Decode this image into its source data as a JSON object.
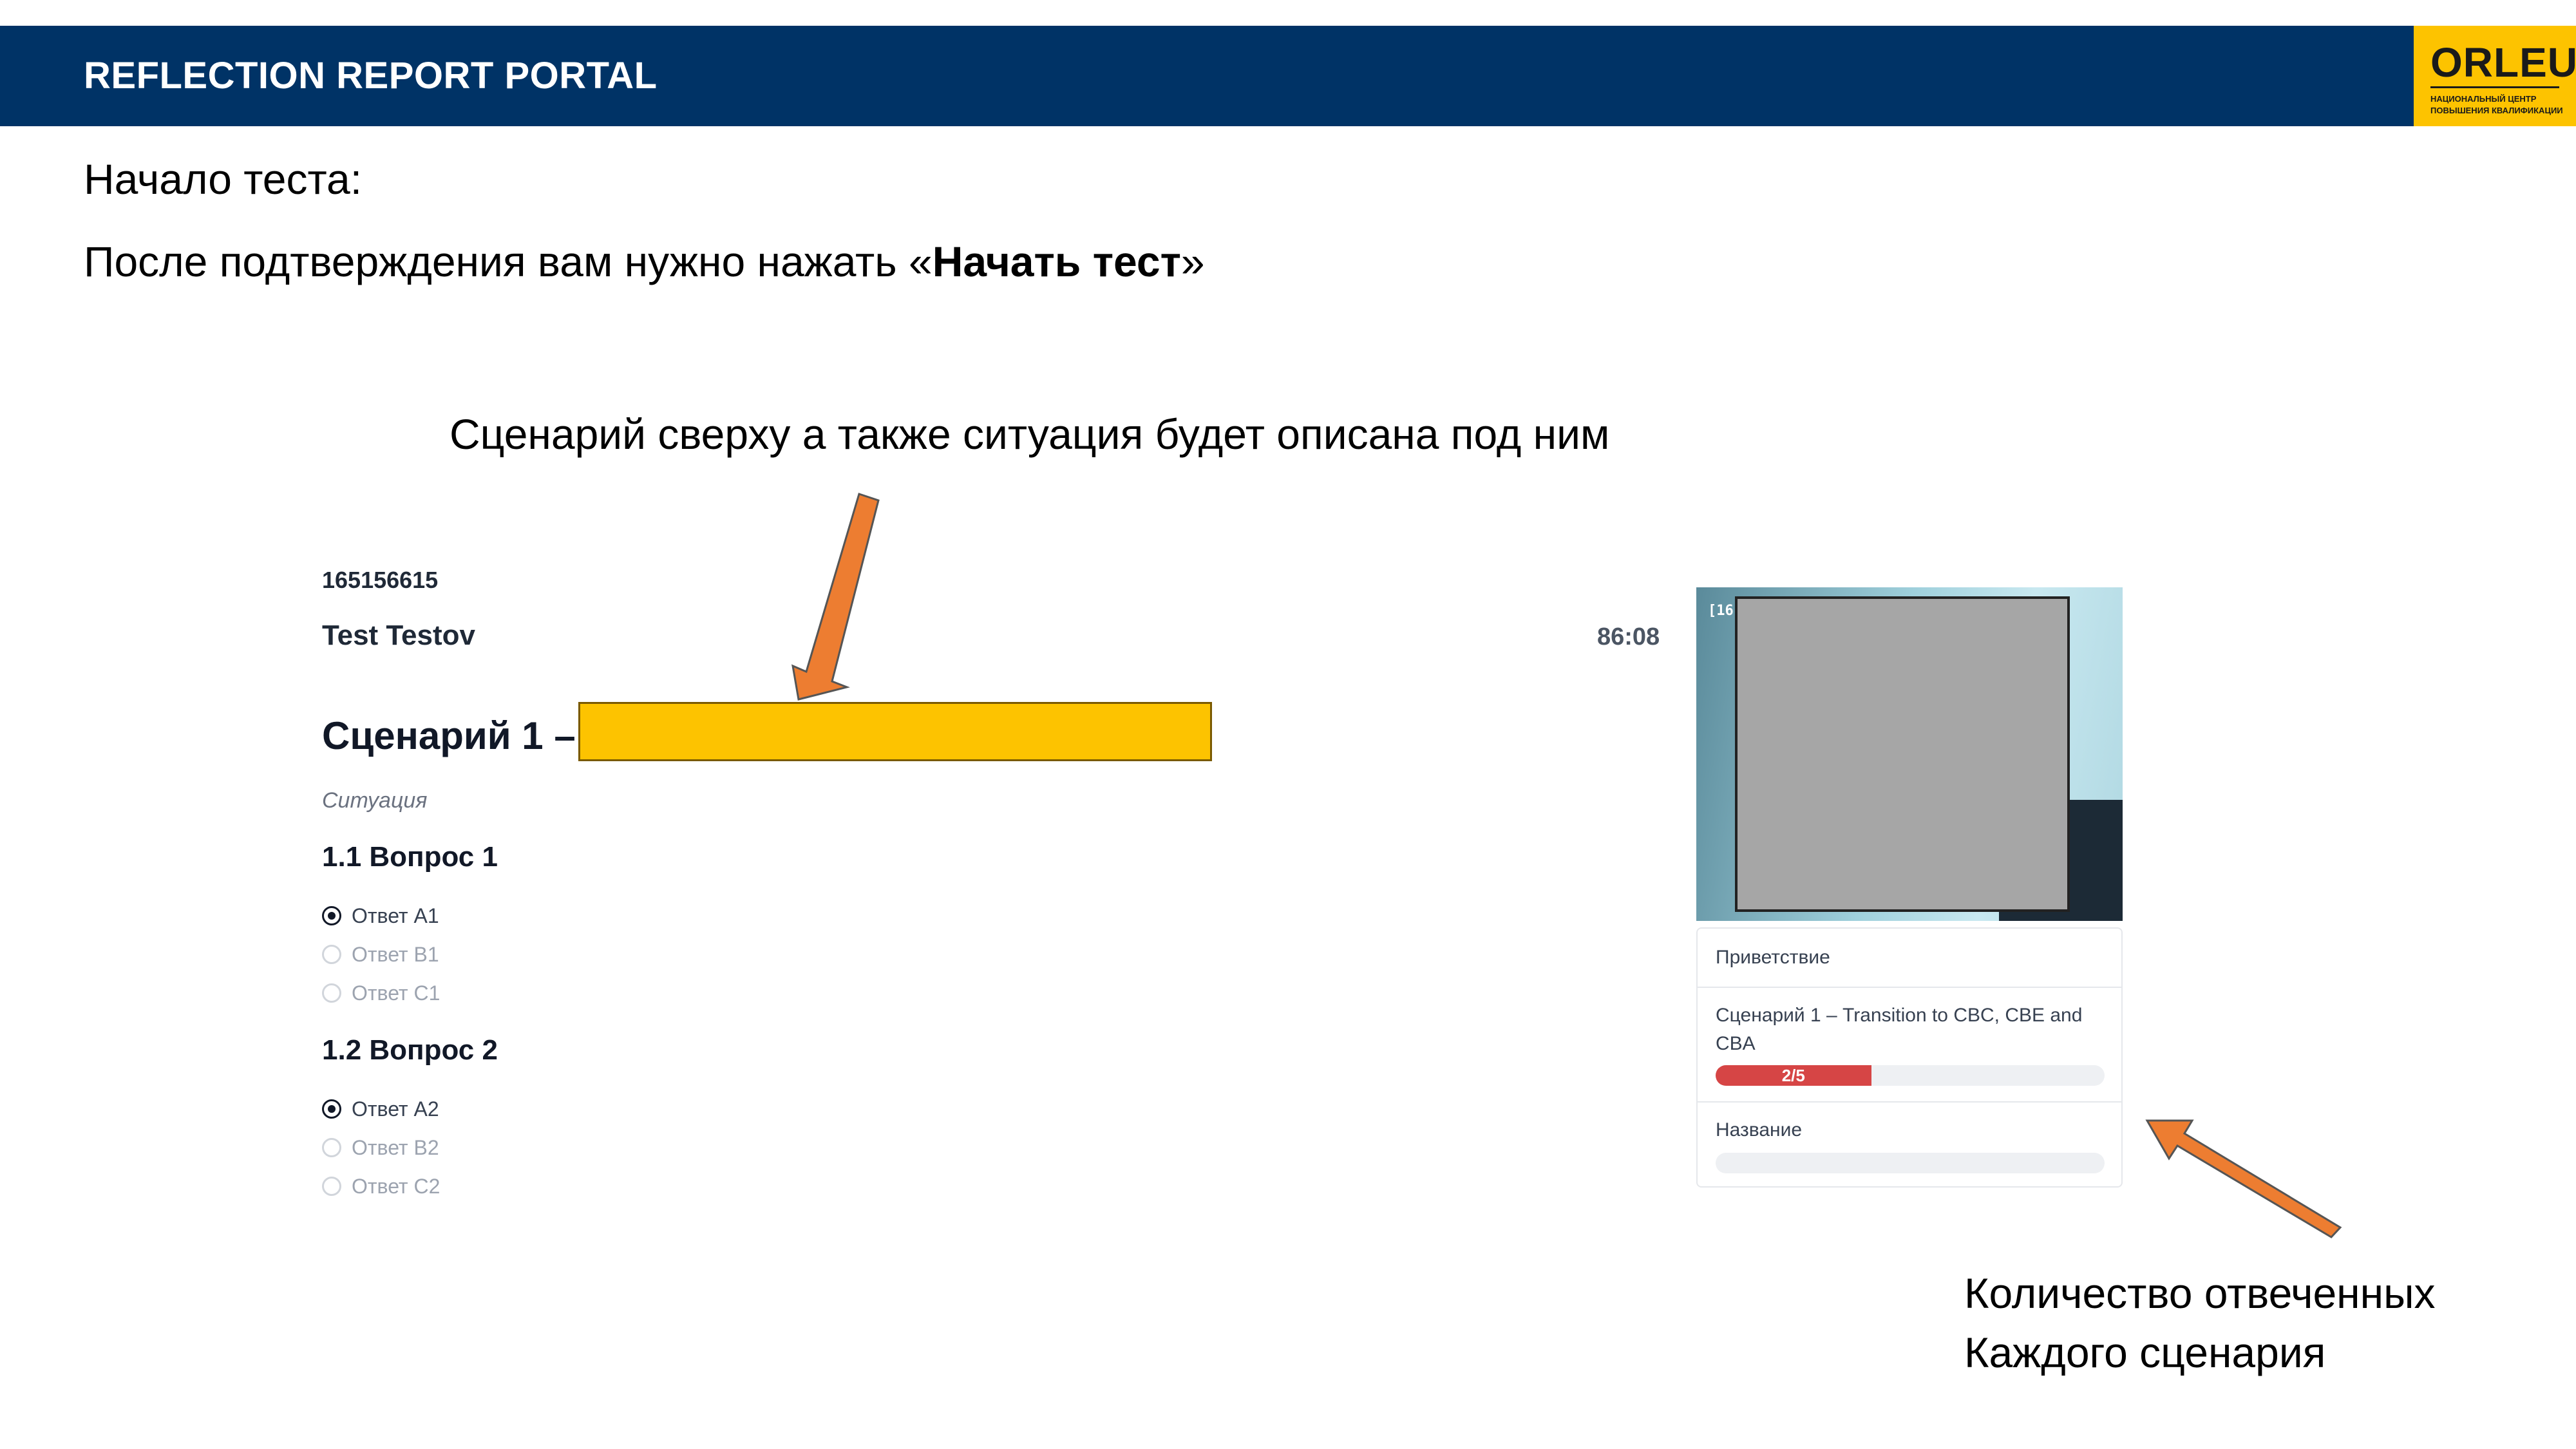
{
  "header": {
    "title": "REFLECTION REPORT PORTAL",
    "logo": {
      "name": "ORLEU",
      "sub1": "НАЦИОНАЛЬНЫЙ ЦЕНТР",
      "sub2": "ПОВЫШЕНИЯ КВАЛИФИКАЦИИ"
    }
  },
  "intro": {
    "line1": "Начало теста:",
    "line2_prefix": "После подтверждения вам нужно нажать «",
    "line2_bold": "Начать тест",
    "line2_suffix": "»"
  },
  "callouts": {
    "top": "Сценарий сверху а также ситуация будет описана под ним",
    "bottom_line1": "Количество отвеченных",
    "bottom_line2": "Каждого сценария"
  },
  "test": {
    "id": "165156615",
    "user_name": "Test Testov",
    "scenario_title": "Сценарий 1 –",
    "situation": "Ситуация",
    "questions": [
      {
        "title": "1.1 Вопрос 1",
        "options": [
          {
            "label": "Ответ A1",
            "selected": true
          },
          {
            "label": "Ответ B1",
            "selected": false
          },
          {
            "label": "Ответ C1",
            "selected": false
          }
        ]
      },
      {
        "title": "1.2 Вопрос 2",
        "options": [
          {
            "label": "Ответ A2",
            "selected": true
          },
          {
            "label": "Ответ B2",
            "selected": false
          },
          {
            "label": "Ответ C2",
            "selected": false
          }
        ]
      }
    ]
  },
  "sidebar": {
    "timer": "86:08",
    "video_tag": "[16",
    "sections": [
      {
        "label": "Приветствие"
      },
      {
        "label_line1": "Сценарий 1 – Transition to CBC, CBE and",
        "label_line2": "CBA",
        "progress_text": "2/5",
        "progress": 0.4
      },
      {
        "label": "Название",
        "progress": 0
      }
    ]
  },
  "colors": {
    "banner": "#003366",
    "logo_bg": "#fdc300",
    "highlight": "#fdc300",
    "arrow": "#ed7d31",
    "progress_fill": "#d64545"
  }
}
